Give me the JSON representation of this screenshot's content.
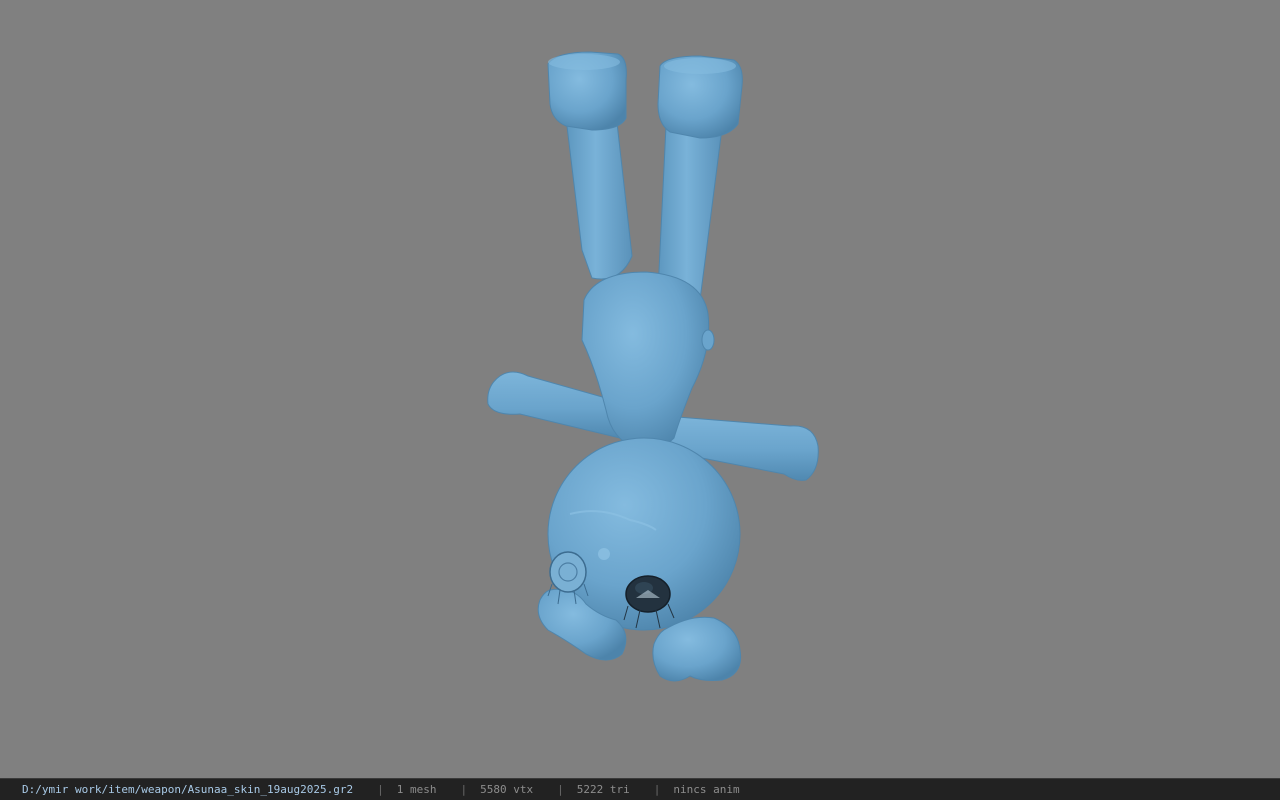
{
  "app": {
    "viewport_background": "#808080",
    "model_color": "#6aa4cc",
    "model_shadow": "#4f86ad",
    "model_highlight": "#8cc0e2"
  },
  "viewport": {
    "model_name": "Asunaa_skin",
    "model_icon": "bunny-model-icon"
  },
  "statusbar": {
    "file_path": "D:/ymir work/item/weapon/Asunaa_skin_19aug2025.gr2",
    "separator": "|",
    "mesh_count": "1 mesh",
    "vertex_count": "5580 vtx",
    "triangle_count": "5222 tri",
    "anim_status": "nincs anim"
  }
}
